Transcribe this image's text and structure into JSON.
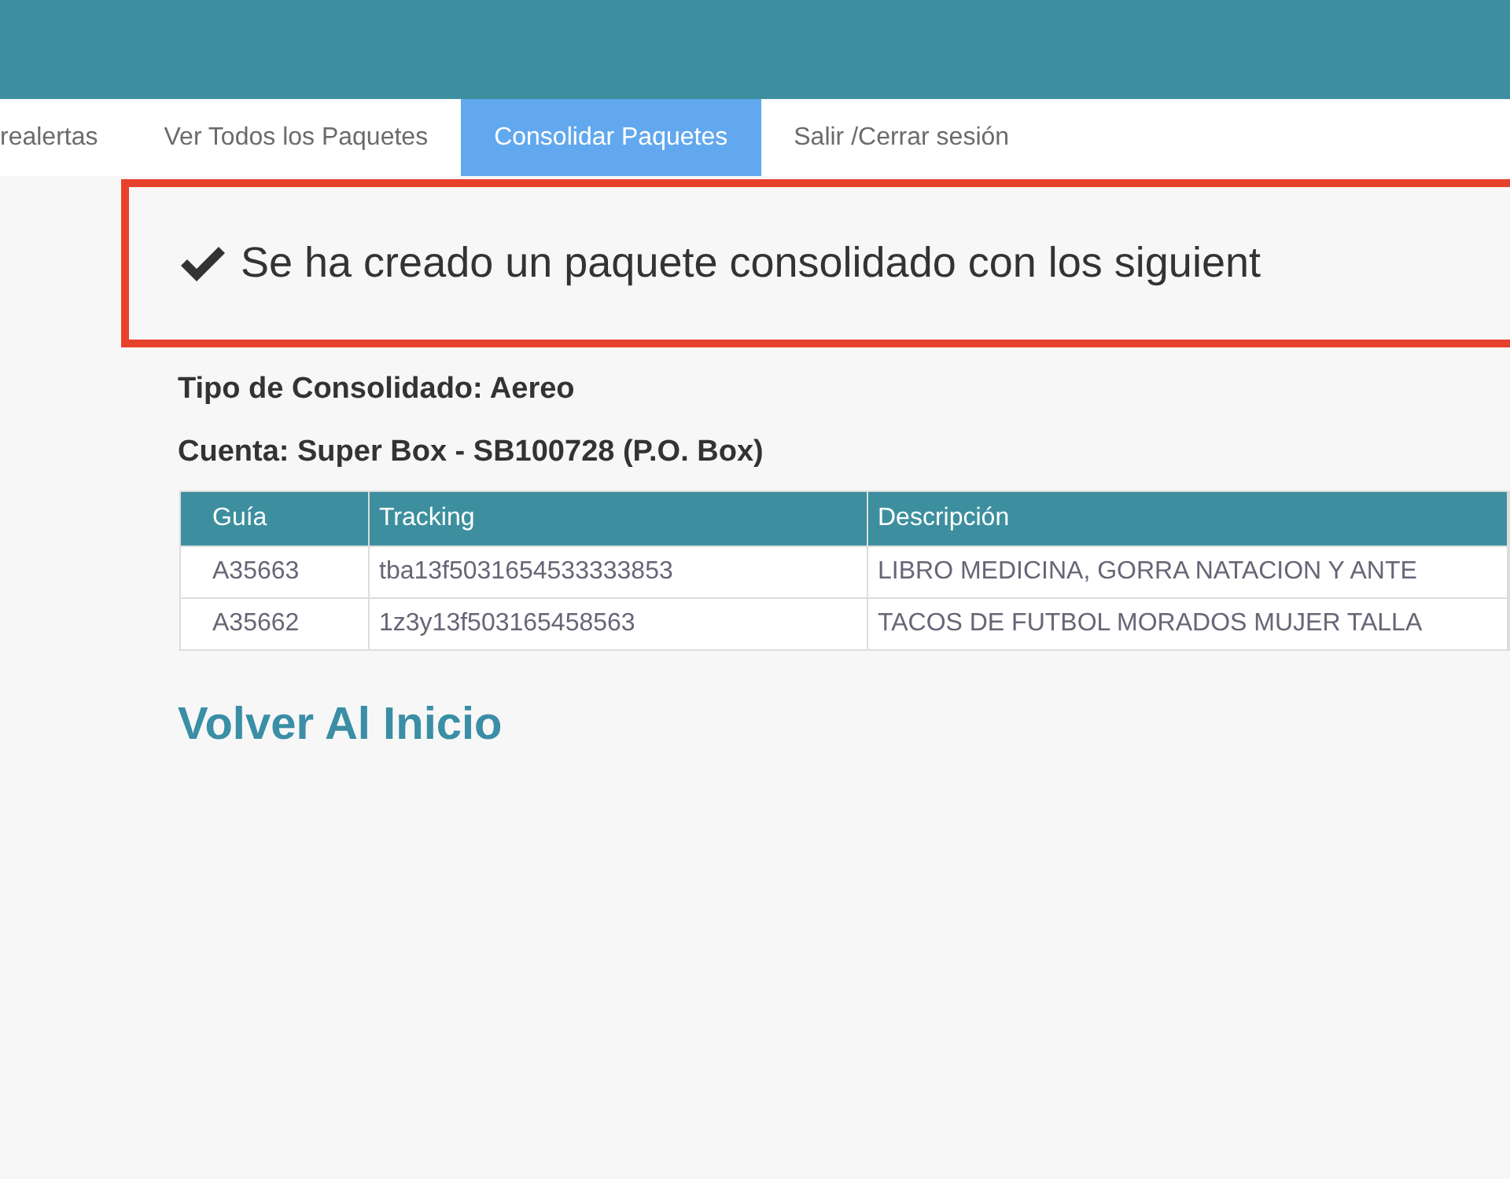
{
  "nav": {
    "tabs": [
      {
        "label": "realertas",
        "selected": false
      },
      {
        "label": "Ver Todos los Paquetes",
        "selected": false
      },
      {
        "label": "Consolidar Paquetes",
        "selected": true
      },
      {
        "label": "Salir /Cerrar sesión",
        "selected": false
      }
    ]
  },
  "alert": {
    "message": "Se ha creado un paquete consolidado con los siguient"
  },
  "details": [
    "Tipo de Consolidado: Aereo",
    "Cuenta: Super Box - SB100728 (P.O. Box)"
  ],
  "table": {
    "columns": [
      "Guía",
      "Tracking",
      "Descripción"
    ],
    "rows": [
      [
        "A35663",
        "tba13f5031654533333853",
        "LIBRO MEDICINA, GORRA NATACION Y ANTE"
      ],
      [
        "A35662",
        "1z3y13f503165458563",
        "TACOS DE FUTBOL MORADOS MUJER TALLA"
      ]
    ]
  },
  "back_link": "Volver Al Inicio"
}
